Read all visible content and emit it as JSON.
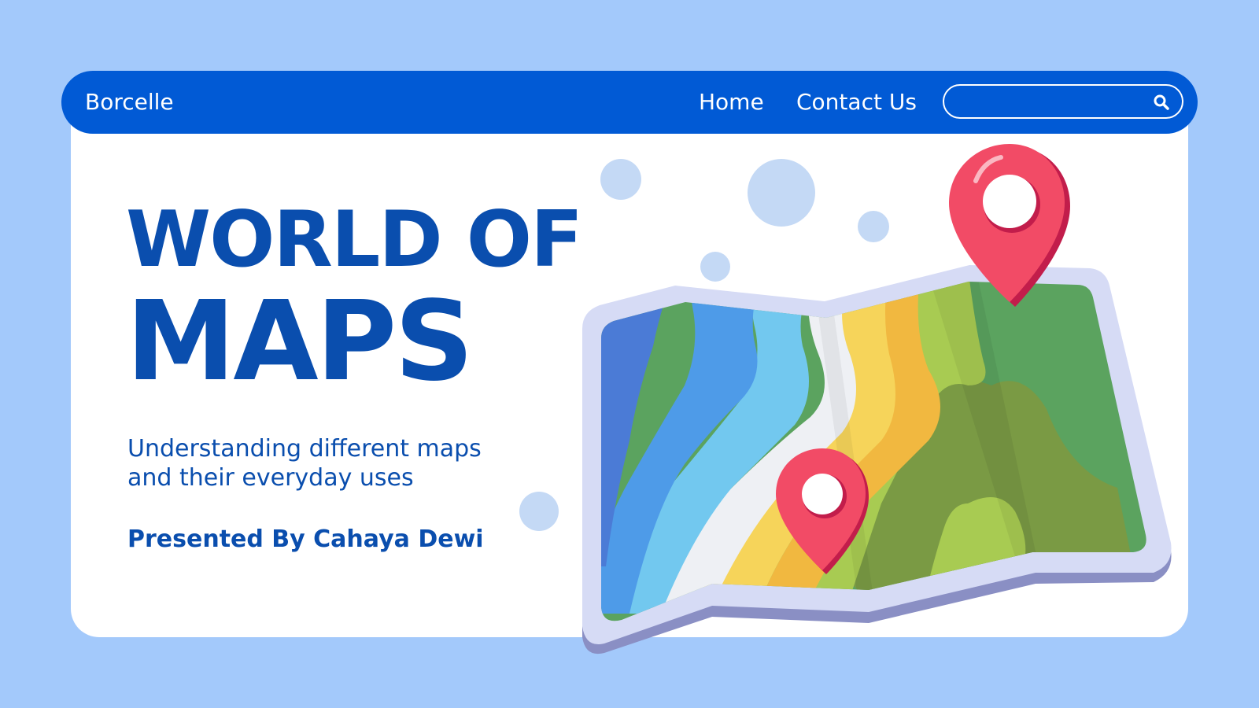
{
  "navbar": {
    "brand": "Borcelle",
    "links": [
      {
        "label": "Home"
      },
      {
        "label": "Contact Us"
      }
    ],
    "search": {
      "placeholder": "",
      "value": "",
      "icon": "search-icon"
    }
  },
  "hero": {
    "title_line1": "WORLD OF",
    "title_line2": "MAPS",
    "subtitle_line1": "Understanding different maps",
    "subtitle_line2": "and their everyday uses",
    "presenter": "Presented By Cahaya Dewi"
  },
  "illustration": {
    "icon": "folded-map-icon",
    "pins": [
      "location-pin-icon",
      "location-pin-icon"
    ]
  },
  "colors": {
    "background": "#a3c9fb",
    "navbar": "#015ad5",
    "card": "#ffffff",
    "text_primary": "#0a4eae",
    "pin": "#f24b66",
    "bubble": "#c4d9f5"
  }
}
